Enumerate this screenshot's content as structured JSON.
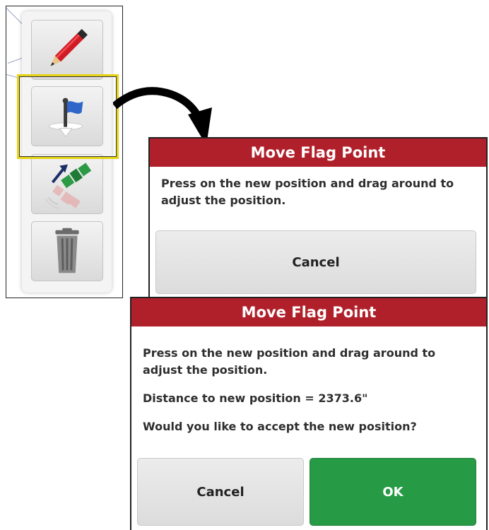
{
  "toolbar": {
    "tools": [
      {
        "name": "edit",
        "icon": "pencil-icon"
      },
      {
        "name": "move-flag",
        "icon": "move-flag-icon",
        "highlighted": true
      },
      {
        "name": "satellite",
        "icon": "satellite-icon"
      },
      {
        "name": "delete",
        "icon": "trash-icon"
      }
    ],
    "highlight_color": "#e6d316"
  },
  "dialog1": {
    "title": "Move Flag Point",
    "message": "Press on the new position and drag around to adjust the position.",
    "cancel_label": "Cancel"
  },
  "dialog2": {
    "title": "Move Flag Point",
    "message": "Press on the new position and drag around to adjust the position.",
    "distance": "Distance to new position = 2373.6\"",
    "question": "Would you like to accept the new position?",
    "cancel_label": "Cancel",
    "ok_label": "OK"
  },
  "colors": {
    "header": "#b0202a",
    "ok": "#279a45"
  }
}
